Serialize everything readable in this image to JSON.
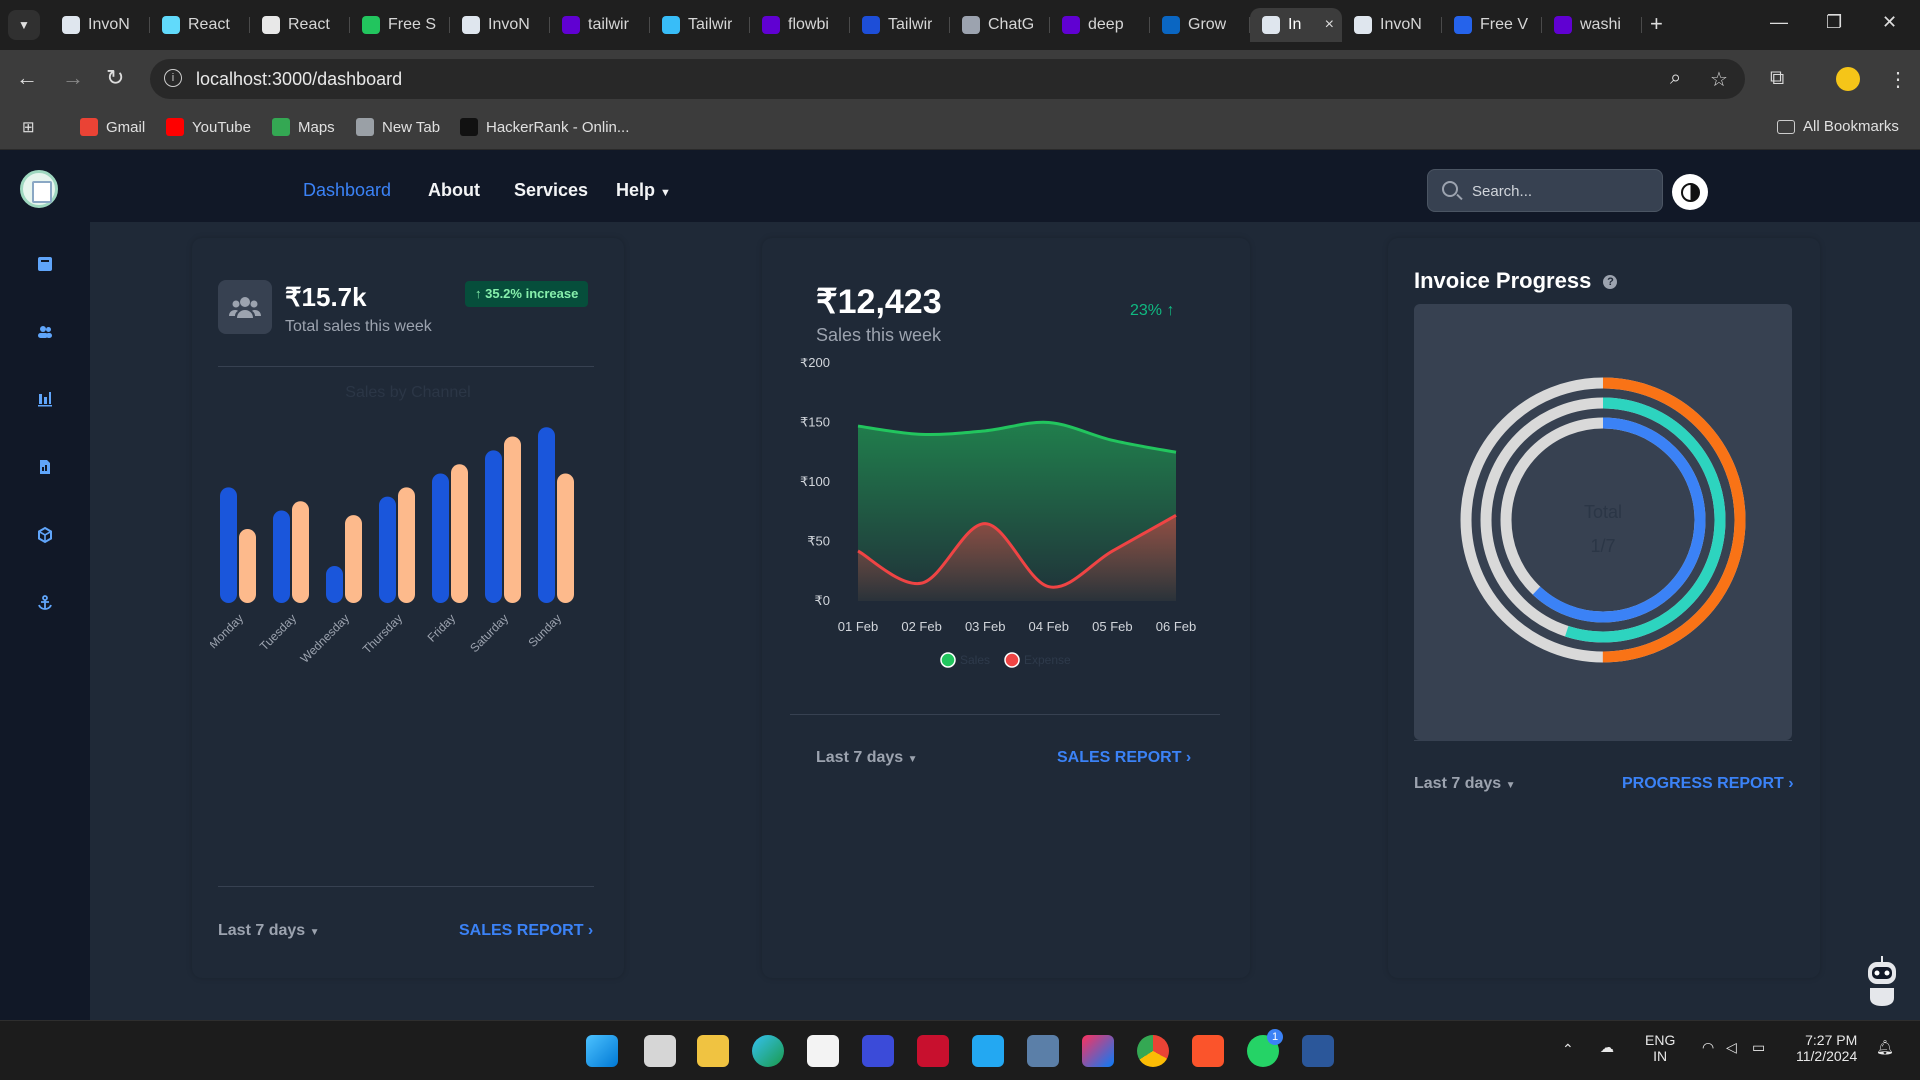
{
  "browser": {
    "tabs": [
      {
        "label": "InvoN",
        "icon": "invo-favicon-icon",
        "color": "#dfe6ee"
      },
      {
        "label": "React",
        "icon": "react-favicon-icon",
        "color": "#61dafb"
      },
      {
        "label": "React",
        "icon": "react-doc-favicon-icon",
        "color": "#e8e8e8"
      },
      {
        "label": "Free S",
        "icon": "free-simple-favicon-icon",
        "color": "#22c55e"
      },
      {
        "label": "InvoN",
        "icon": "invo-favicon-icon",
        "color": "#dfe6ee"
      },
      {
        "label": "tailwir",
        "icon": "yahoo-favicon-icon",
        "color": "#6001d2"
      },
      {
        "label": "Tailwir",
        "icon": "tailwind-favicon-icon",
        "color": "#38bdf8"
      },
      {
        "label": "flowbi",
        "icon": "yahoo-favicon-icon",
        "color": "#6001d2"
      },
      {
        "label": "Tailwir",
        "icon": "flowbite-favicon-icon",
        "color": "#1d4ed8"
      },
      {
        "label": "ChatG",
        "icon": "chatgpt-favicon-icon",
        "color": "#9ca3af"
      },
      {
        "label": "deep",
        "icon": "yahoo-favicon-icon",
        "color": "#6001d2"
      },
      {
        "label": "Grow",
        "icon": "linkedin-favicon-icon",
        "color": "#0a66c2"
      },
      {
        "label": "In",
        "icon": "invo-favicon-icon",
        "color": "#dfe6ee",
        "active": true
      },
      {
        "label": "InvoN",
        "icon": "invo-favicon-icon",
        "color": "#dfe6ee"
      },
      {
        "label": "Free V",
        "icon": "forms-favicon-icon",
        "color": "#2563eb"
      },
      {
        "label": "washi",
        "icon": "yahoo-favicon-icon",
        "color": "#6001d2"
      }
    ],
    "url": "localhost:3000/dashboard",
    "bookmarks": [
      {
        "label": "Gmail",
        "icon": "gmail-icon",
        "color": "#ea4335"
      },
      {
        "label": "YouTube",
        "icon": "youtube-icon",
        "color": "#ff0000"
      },
      {
        "label": "Maps",
        "icon": "maps-icon",
        "color": "#34a853"
      },
      {
        "label": "New Tab",
        "icon": "globe-icon",
        "color": "#9aa0a6"
      },
      {
        "label": "HackerRank - Onlin...",
        "icon": "hackerrank-icon",
        "color": "#111111"
      }
    ],
    "all_bookmarks": "All Bookmarks"
  },
  "nav": {
    "links": [
      "Dashboard",
      "About",
      "Services",
      "Help"
    ],
    "search_placeholder": "Search..."
  },
  "sidebar_icons": [
    "book-icon",
    "users-icon",
    "bar-chart-icon",
    "invoice-icon",
    "cube-icon",
    "anchor-icon"
  ],
  "card1": {
    "amount": "₹15.7k",
    "subtitle": "Total sales this week",
    "badge": "↑ 35.2% increase",
    "chart_title": "Sales by Channel",
    "footer_range": "Last 7 days",
    "footer_link": "SALES REPORT"
  },
  "card2": {
    "amount": "₹12,423",
    "subtitle": "Sales this week",
    "growth": "23% ↑",
    "footer_range": "Last 7 days",
    "footer_link": "SALES REPORT"
  },
  "card3": {
    "title": "Invoice Progress",
    "center_label": "Total",
    "center_value": "1/7",
    "footer_range": "Last 7 days",
    "footer_link": "PROGRESS REPORT"
  },
  "chart_data": [
    {
      "type": "bar",
      "title": "Sales by Channel",
      "categories": [
        "Monday",
        "Tuesday",
        "Wednesday",
        "Thursday",
        "Friday",
        "Saturday",
        "Sunday"
      ],
      "series": [
        {
          "values": [
            125,
            100,
            40,
            115,
            140,
            165,
            190
          ],
          "color": "#1a56db"
        },
        {
          "values": [
            80,
            110,
            95,
            125,
            150,
            180,
            140
          ],
          "color": "#fdba8c"
        }
      ],
      "ylim": [
        0,
        200
      ]
    },
    {
      "type": "area",
      "x": [
        "01 Feb",
        "02 Feb",
        "03 Feb",
        "04 Feb",
        "05 Feb",
        "06 Feb"
      ],
      "series": [
        {
          "name": "Sales",
          "values": [
            147,
            140,
            143,
            150,
            135,
            125
          ],
          "color": "#22c55e"
        },
        {
          "name": "Expense",
          "values": [
            42,
            15,
            65,
            12,
            42,
            72
          ],
          "color": "#ef4444"
        }
      ],
      "y_ticks": [
        "₹0",
        "₹50",
        "₹100",
        "₹150",
        "₹200"
      ],
      "ylim": [
        0,
        200
      ]
    },
    {
      "type": "pie",
      "title": "Invoice Progress",
      "rings": [
        {
          "value": 50,
          "color": "#f97316"
        },
        {
          "value": 55,
          "color": "#2dd4bf"
        },
        {
          "value": 62,
          "color": "#3b82f6"
        }
      ],
      "track_color": "#d9d9d9"
    }
  ],
  "taskbar": {
    "lang": "ENG",
    "region": "IN",
    "time": "7:27 PM",
    "date": "11/2/2024",
    "whatsapp_badge": "1"
  }
}
